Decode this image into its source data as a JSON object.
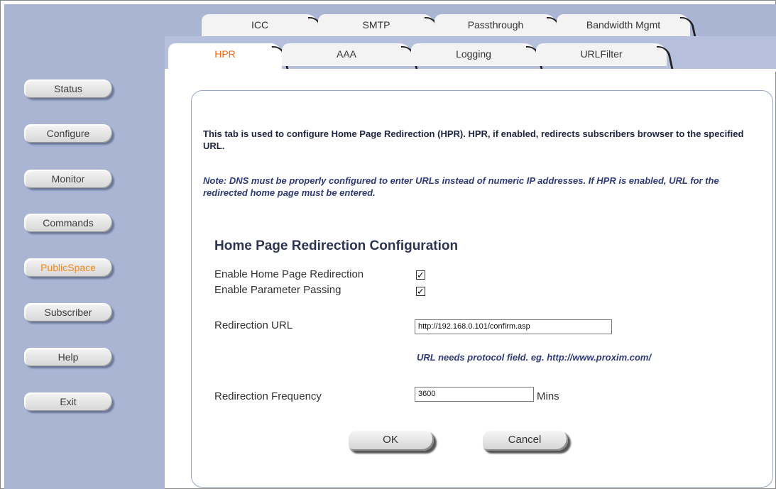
{
  "sidebar": {
    "items": [
      {
        "label": "Status",
        "active": false
      },
      {
        "label": "Configure",
        "active": false
      },
      {
        "label": "Monitor",
        "active": false
      },
      {
        "label": "Commands",
        "active": false
      },
      {
        "label": "PublicSpace",
        "active": true
      },
      {
        "label": "Subscriber",
        "active": false
      },
      {
        "label": "Help",
        "active": false
      },
      {
        "label": "Exit",
        "active": false
      }
    ]
  },
  "tabs": {
    "row1": [
      "ICC",
      "SMTP",
      "Passthrough",
      "Bandwidth Mgmt"
    ],
    "row2": [
      "HPR",
      "AAA",
      "Logging",
      "URLFilter"
    ],
    "selected": "HPR"
  },
  "content": {
    "intro": "This tab is used to configure Home Page Redirection (HPR). HPR, if enabled, redirects subscribers browser to the specified URL.",
    "note": "Note: DNS must be properly configured to enter URLs instead of numeric IP addresses. If HPR is enabled, URL for the redirected home page must be entered.",
    "section_title": "Home Page Redirection Configuration",
    "fields": {
      "enable_hpr_label": "Enable Home Page Redirection",
      "enable_hpr_checked": true,
      "enable_param_label": "Enable Parameter Passing",
      "enable_param_checked": true,
      "url_label": "Redirection URL",
      "url_value": "http://192.168.0.101/confirm.asp",
      "url_hint": "URL needs protocol field. eg. http://www.proxim.com/",
      "freq_label": "Redirection Frequency",
      "freq_value": "3600",
      "freq_unit": "Mins"
    },
    "buttons": {
      "ok": "OK",
      "cancel": "Cancel"
    }
  },
  "colors": {
    "sidebar_bg": "#a9b5d3",
    "active_text": "#ef8a1e",
    "note_text": "#2d3a78"
  }
}
